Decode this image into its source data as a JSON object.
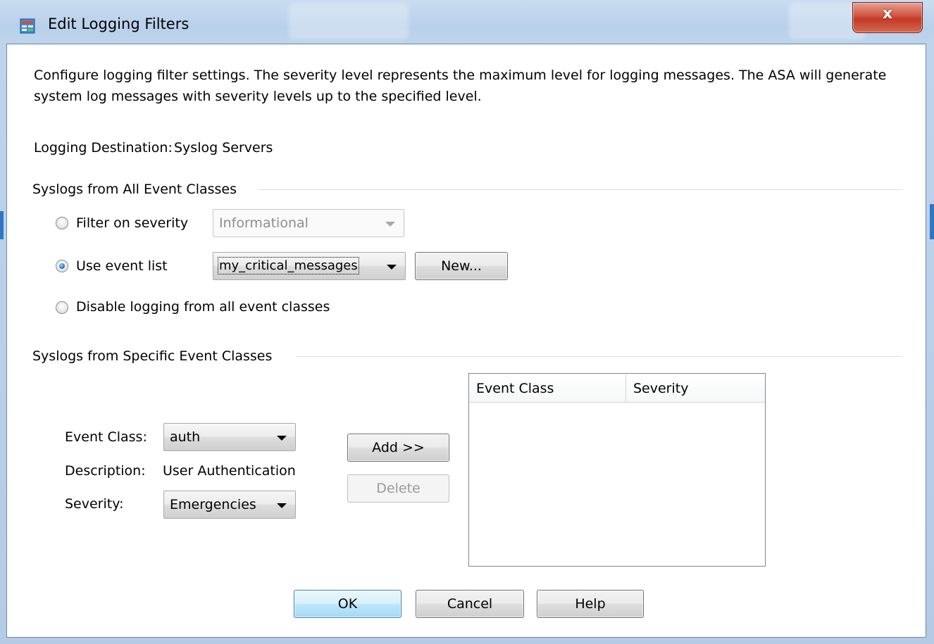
{
  "window": {
    "title": "Edit Logging Filters",
    "close_label": "x"
  },
  "intro": {
    "text": "Configure logging filter settings. The severity level represents the maximum level for logging messages. The ASA will generate system log messages with severity levels up to the specified level."
  },
  "destination": {
    "label": "Logging Destination:",
    "value": "Syslog Servers"
  },
  "all_classes": {
    "group_label": "Syslogs from All Event Classes",
    "filter_severity_label": "Filter on severity",
    "severity_value": "Informational",
    "use_event_list_label": "Use event list",
    "event_list_value": "my_critical_messages",
    "new_button": "New...",
    "disable_label": "Disable logging from all event classes",
    "selected_option": "use_event_list"
  },
  "specific_classes": {
    "group_label": "Syslogs from Specific Event Classes",
    "event_class_label": "Event Class:",
    "event_class_value": "auth",
    "description_label": "Description:",
    "description_value": "User Authentication",
    "severity_label": "Severity:",
    "severity_value": "Emergencies",
    "add_button": "Add >>",
    "delete_button": "Delete",
    "table": {
      "columns": [
        "Event Class",
        "Severity"
      ],
      "rows": []
    }
  },
  "footer": {
    "ok": "OK",
    "cancel": "Cancel",
    "help": "Help"
  },
  "colors": {
    "titlebar": "#c9dcf1",
    "close_button": "#c23a26",
    "radio_checked": "#2b7fc9",
    "default_button": "#bee6fd"
  }
}
